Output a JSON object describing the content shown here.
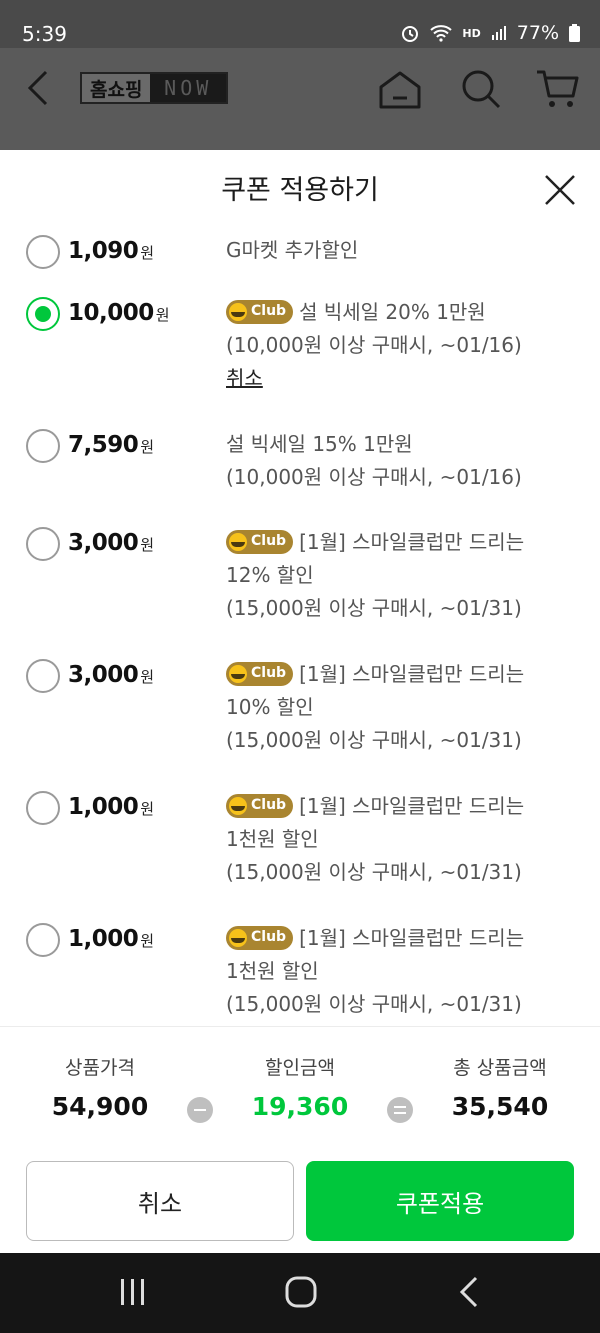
{
  "status_bar": {
    "time": "5:39",
    "network": "HD",
    "battery": "77%"
  },
  "app_header": {
    "logo_korean": "홈쇼핑",
    "logo_now": "NOW"
  },
  "sheet": {
    "title": "쿠폰 적용하기",
    "coupons": [
      {
        "amount": "1,090",
        "unit": "원",
        "selected": false,
        "club": false,
        "lines": [
          "G마켓 추가할인"
        ]
      },
      {
        "amount": "10,000",
        "unit": "원",
        "selected": true,
        "club": true,
        "club_label": "Club",
        "lines": [
          "설 빅세일 20% 1만원",
          "(10,000원 이상 구매시, ~01/16)"
        ],
        "cancel_label": "취소"
      },
      {
        "amount": "7,590",
        "unit": "원",
        "selected": false,
        "club": false,
        "lines": [
          "설 빅세일 15% 1만원",
          "(10,000원 이상 구매시, ~01/16)"
        ]
      },
      {
        "amount": "3,000",
        "unit": "원",
        "selected": false,
        "club": true,
        "club_label": "Club",
        "lines": [
          "[1월] 스마일클럽만 드리는",
          "12% 할인",
          "(15,000원 이상 구매시, ~01/31)"
        ]
      },
      {
        "amount": "3,000",
        "unit": "원",
        "selected": false,
        "club": true,
        "club_label": "Club",
        "lines": [
          "[1월] 스마일클럽만 드리는",
          "10% 할인",
          "(15,000원 이상 구매시, ~01/31)"
        ]
      },
      {
        "amount": "1,000",
        "unit": "원",
        "selected": false,
        "club": true,
        "club_label": "Club",
        "lines": [
          "[1월] 스마일클럽만 드리는",
          "1천원 할인",
          "(15,000원 이상 구매시, ~01/31)"
        ]
      },
      {
        "amount": "1,000",
        "unit": "원",
        "selected": false,
        "club": true,
        "club_label": "Club",
        "lines": [
          "[1월] 스마일클럽만 드리는",
          "1천원 할인",
          "(15,000원 이상 구매시, ~01/31)"
        ]
      }
    ]
  },
  "summary": {
    "price_label": "상품가격",
    "price": "54,900",
    "discount_label": "할인금액",
    "discount": "19,360",
    "total_label": "총 상품금액",
    "total": "35,540",
    "discount_color": "#00c73c"
  },
  "buttons": {
    "cancel": "취소",
    "apply": "쿠폰적용",
    "apply_color": "#00c73c"
  },
  "icons": [
    "back-icon",
    "home-icon",
    "search-icon",
    "cart-icon",
    "close-icon",
    "club-smile-icon",
    "recents-icon",
    "home-nav-icon",
    "back-nav-icon"
  ]
}
